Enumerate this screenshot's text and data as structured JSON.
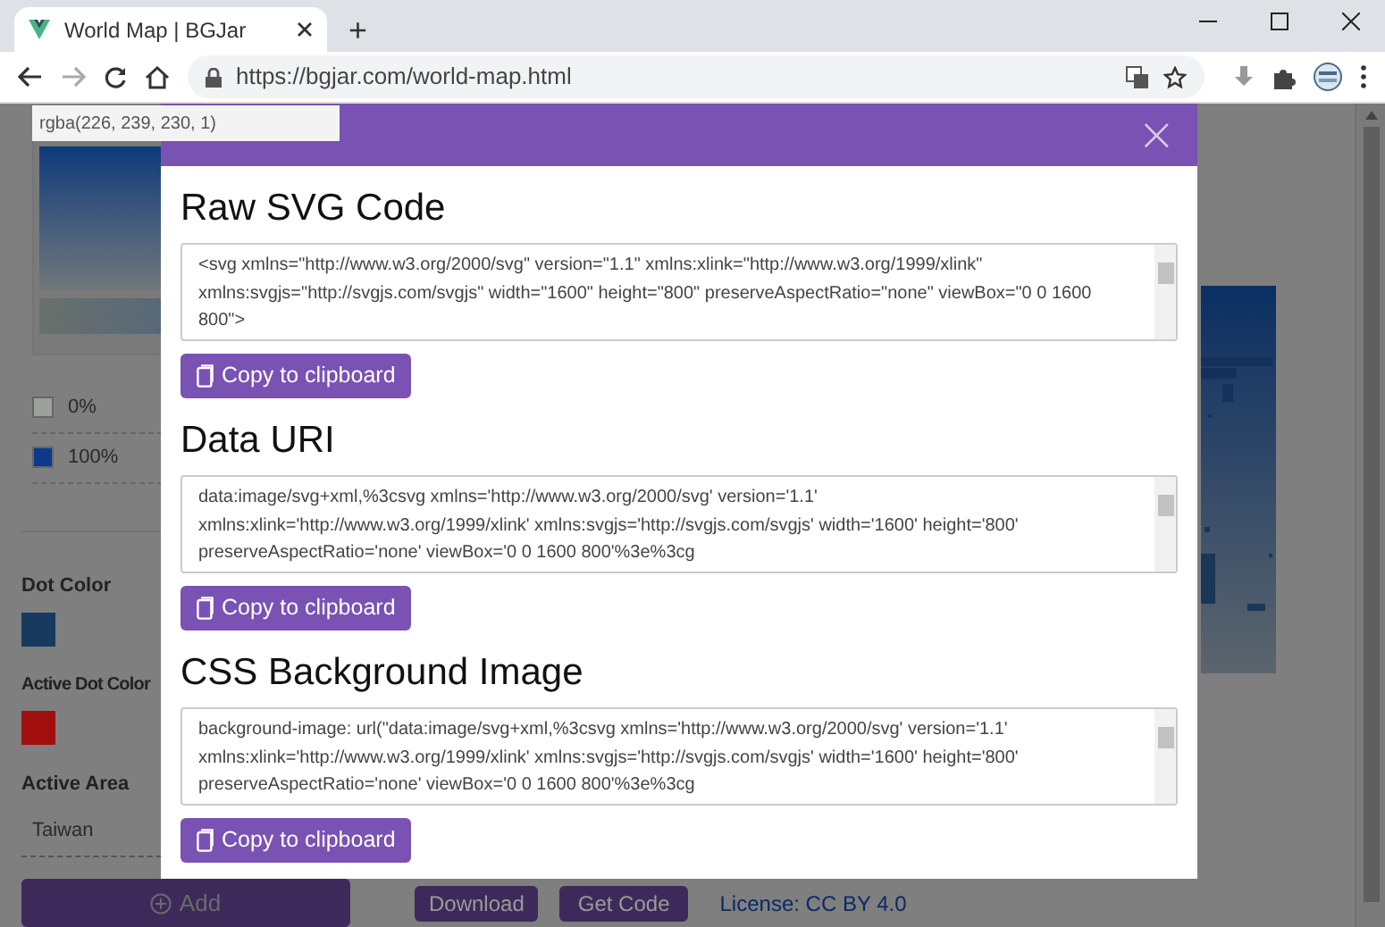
{
  "browser": {
    "tab_title": "World Map | BGJar",
    "new_tab": "+",
    "address": "https://bgjar.com/world-map.html"
  },
  "tooltip": "rgba(226, 239, 230, 1)",
  "sidebar": {
    "stops": [
      {
        "label": "0%",
        "color": "#9aa09c"
      },
      {
        "label": "100%",
        "color": "#0b3a8c"
      }
    ],
    "dot_color": {
      "label": "Dot Color",
      "color": "#173a5e"
    },
    "active_dot_color": {
      "label": "Active Dot Color",
      "color": "#a10e0e"
    },
    "active_area": {
      "label": "Active Area",
      "value": "Taiwan"
    },
    "add_button": "Add"
  },
  "footer": {
    "buttons": [
      "Download",
      "Get Code"
    ],
    "license": "License: CC BY 4.0"
  },
  "modal": {
    "close": "×",
    "sections": [
      {
        "title": "Raw SVG Code",
        "lines": [
          "<svg xmlns=\"http://www.w3.org/2000/svg\" version=\"1.1\" xmlns:xlink=\"http://www.w3.org/1999/xlink\"",
          "xmlns:svgjs=\"http://svgjs.com/svgjs\" width=\"1600\" height=\"800\" preserveAspectRatio=\"none\" viewBox=\"0 0 1600",
          "800\">"
        ],
        "button": "Copy to clipboard"
      },
      {
        "title": "Data URI",
        "lines": [
          "data:image/svg+xml,%3csvg xmlns='http://www.w3.org/2000/svg' version='1.1'",
          "xmlns:xlink='http://www.w3.org/1999/xlink' xmlns:svgjs='http://svgjs.com/svgjs' width='1600' height='800'",
          "preserveAspectRatio='none' viewBox='0 0 1600 800'%3e%3cg"
        ],
        "button": "Copy to clipboard"
      },
      {
        "title": "CSS Background Image",
        "lines": [
          "background-image: url(\"data:image/svg+xml,%3csvg xmlns='http://www.w3.org/2000/svg' version='1.1'",
          "xmlns:xlink='http://www.w3.org/1999/xlink' xmlns:svgjs='http://svgjs.com/svgjs' width='1600' height='800'",
          "preserveAspectRatio='none' viewBox='0 0 1600 800'%3e%3cg"
        ],
        "button": "Copy to clipboard"
      }
    ]
  }
}
